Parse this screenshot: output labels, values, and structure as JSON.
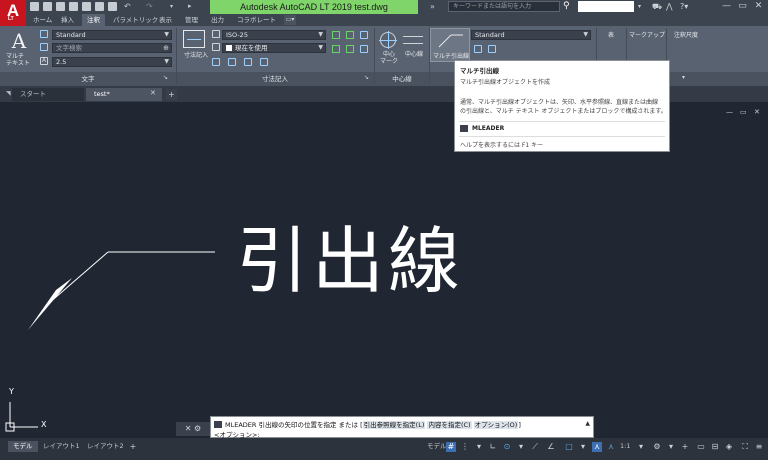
{
  "app": {
    "logo_letter": "A",
    "logo_sub": "LT",
    "title": "Autodesk AutoCAD LT 2019    test.dwg",
    "search_placeholder": "キーワードまたは語句を入力",
    "window_controls": [
      "—",
      "▭",
      "✕"
    ]
  },
  "ribbon_tabs": [
    "ホーム",
    "挿入",
    "注釈",
    "パラメトリック",
    "表示",
    "管理",
    "出力",
    "コラボレート"
  ],
  "ribbon_tabs_active": "注釈",
  "ribbon": {
    "text_panel": {
      "big_button_label": "マルチ\nテキスト",
      "style_value": "Standard",
      "search_placeholder": "文字検索",
      "height_value": "2.5",
      "title": "文字"
    },
    "dim_panel": {
      "big_button_label": "寸法記入",
      "style_value": "ISO-25",
      "layer_value": "現在を使用",
      "title": "寸法記入"
    },
    "center_panel": {
      "center_mark_label": "中心\nマーク",
      "centerline_label": "中心線",
      "title": "中心線"
    },
    "leader_panel": {
      "big_button_label": "マルチ引出線",
      "style_value": "Standard"
    },
    "table_label": "表",
    "markup_label": "マークアップ",
    "annoscale_label": "注釈尺度"
  },
  "tooltip": {
    "title": "マルチ引出線",
    "subtitle": "マルチ引出線オブジェクトを作成",
    "desc_lines": [
      "通常、マルチ引出線オブジェクトは、矢印、水平参照線、直線または曲線",
      "の引出線と、マルチ テキスト オブジェクトまたはブロックで構成されます。"
    ],
    "command": "MLEADER",
    "help": "ヘルプを表示するには F1 キー"
  },
  "file_tabs": [
    "スタート",
    "test*"
  ],
  "file_tabs_active": "test*",
  "viewport": {
    "big_text": "引出線",
    "axis_y": "Y",
    "axis_x": "X",
    "controls": [
      "—",
      "▭",
      "✕"
    ]
  },
  "cmdline": {
    "line1_prefix": "MLEADER 引出線の矢印の位置を指定 または [",
    "opt1": "引出参照線を指定(L)",
    "opt2": "内容を指定(C)",
    "opt3": "オプション(O)",
    "line1_suffix": "]",
    "line2": "<オプション>:"
  },
  "layout_tabs": [
    "モデル",
    "レイアウト1",
    "レイアウト2"
  ],
  "layout_tabs_active": "モデル",
  "status": {
    "model_label": "モデル",
    "scale_label": "1:1"
  },
  "colors": {
    "accent_green": "#7fd46a",
    "app_red": "#c8141e",
    "ribbon_gray": "#596271",
    "viewport_bg": "#202733"
  }
}
